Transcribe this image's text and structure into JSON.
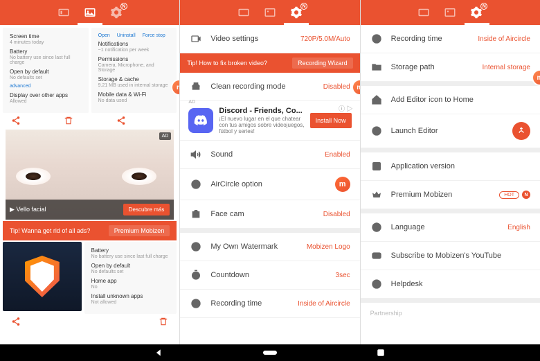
{
  "topbar": {
    "badge": "N"
  },
  "panel1": {
    "card1": {
      "i1": {
        "t": "Screen time",
        "s": "4 minutes today"
      },
      "i2": {
        "t": "Battery",
        "s": "No battery use since last full charge"
      },
      "i3": {
        "t": "Open by default",
        "s": "No defaults set"
      },
      "i4": {
        "t": "Display over other apps",
        "s": "Allowed"
      },
      "link": "advanced"
    },
    "card2": {
      "links": {
        "open": "Open",
        "uninstall": "Uninstall",
        "force": "Force stop"
      },
      "i1": {
        "t": "Notifications",
        "s": "~1 notification per week"
      },
      "i2": {
        "t": "Permissions",
        "s": "Camera, Microphone, and Storage"
      },
      "i3": {
        "t": "Storage & cache",
        "s": "9.21 MB used in internal storage"
      },
      "i4": {
        "t": "Mobile data & Wi-Fi",
        "s": "No data used"
      }
    },
    "ad": {
      "tag": "AD",
      "title": "Vello facial",
      "cta": "Descubre más",
      "arrow": "▶"
    },
    "tip": {
      "text": "Tip! Wanna get rid of all ads?",
      "button": "Premium Mobizen"
    },
    "card3": {
      "i1": {
        "t": "Battery",
        "s": "No battery use since last full charge"
      },
      "i2": {
        "t": "Open by default",
        "s": "No defaults set"
      },
      "i3": {
        "t": "Home app",
        "s": "No"
      },
      "i4": {
        "t": "Install unknown apps",
        "s": "Not allowed"
      }
    }
  },
  "panel2": {
    "r1": {
      "label": "Video settings",
      "val": "720P/5.0M/Auto"
    },
    "tip": {
      "text": "Tip! How to fix broken video?",
      "button": "Recording Wizard"
    },
    "r2": {
      "label": "Clean recording mode",
      "val": "Disabled"
    },
    "ad": {
      "tag": "AD",
      "icons": "ⓘ ▷",
      "title": "Discord - Friends, Co...",
      "sub": "¡El nuevo lugar en el que chatear con tus amigos sobre videojuegos, fútbol y series!",
      "cta": "Install Now"
    },
    "r3": {
      "label": "Sound",
      "val": "Enabled"
    },
    "r4": {
      "label": "AirCircle option"
    },
    "r5": {
      "label": "Face cam",
      "val": "Disabled"
    },
    "r6": {
      "label": "My Own Watermark",
      "val": "Mobizen Logo"
    },
    "r7": {
      "label": "Countdown",
      "val": "3sec"
    },
    "r8": {
      "label": "Recording time",
      "val": "Inside of Aircircle"
    }
  },
  "panel3": {
    "r1": {
      "label": "Recording time",
      "val": "Inside of Aircircle"
    },
    "r2": {
      "label": "Storage path",
      "val": "Internal storage"
    },
    "r3": {
      "label": "Add Editor icon to Home"
    },
    "r4": {
      "label": "Launch Editor"
    },
    "r5": {
      "label": "Application version"
    },
    "r6": {
      "label": "Premium Mobizen",
      "chip": "HOT",
      "badge": "N"
    },
    "r7": {
      "label": "Language",
      "val": "English"
    },
    "r8": {
      "label": "Subscribe to Mobizen's YouTube"
    },
    "r9": {
      "label": "Helpdesk"
    },
    "footer": "Partnership"
  },
  "mobi_letter": "m"
}
